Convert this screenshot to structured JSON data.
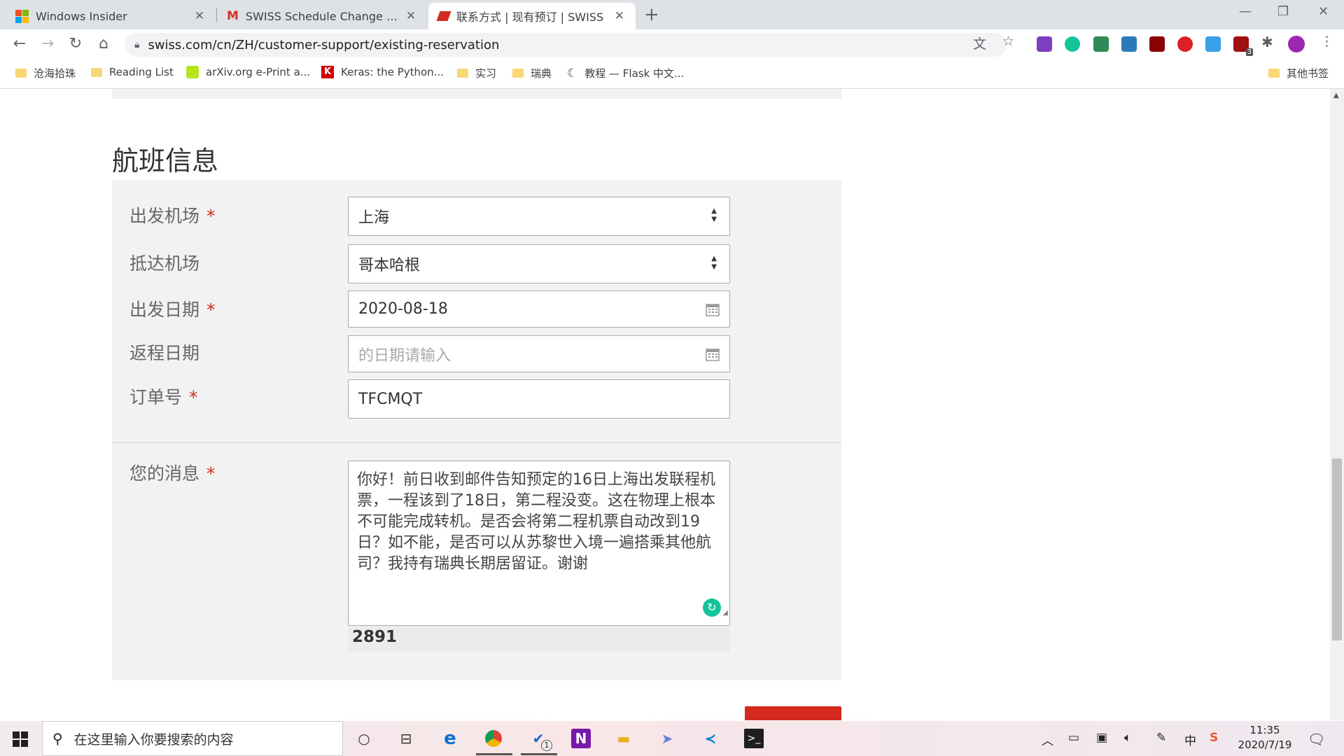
{
  "browser": {
    "tabs": [
      {
        "title": "Windows Insider",
        "active": false
      },
      {
        "title": "SWISS Schedule Change for Bo",
        "active": false
      },
      {
        "title": "联系方式 | 现有预订 | SWISS",
        "active": true
      }
    ],
    "url": "swiss.com/cn/ZH/customer-support/existing-reservation",
    "bookmarks": [
      {
        "label": "沧海拾珠",
        "icon": "folder-icon"
      },
      {
        "label": "Reading List",
        "icon": "folder-icon"
      },
      {
        "label": "arXiv.org e-Print a...",
        "icon": "arxiv-icon"
      },
      {
        "label": "Keras: the Python...",
        "icon": "keras-icon"
      },
      {
        "label": "实习",
        "icon": "folder-icon"
      },
      {
        "label": "瑞典",
        "icon": "folder-icon"
      },
      {
        "label": "教程 — Flask 中文...",
        "icon": "flask-icon"
      }
    ],
    "other_bookmarks": "其他书签",
    "extension_badge": "3"
  },
  "form": {
    "section_title": "航班信息",
    "departure_airport": {
      "label": "出发机场",
      "required_mark": "*",
      "value": "上海"
    },
    "arrival_airport": {
      "label": "抵达机场",
      "value": "哥本哈根"
    },
    "departure_date": {
      "label": "出发日期",
      "required_mark": "*",
      "value": "2020-08-18"
    },
    "return_date": {
      "label": "返程日期",
      "placeholder": "的日期请输入"
    },
    "booking_number": {
      "label": "订单号",
      "required_mark": "*",
      "value": "TFCMQT"
    },
    "message": {
      "label": "您的消息",
      "required_mark": "*",
      "value": "你好！前日收到邮件告知预定的16日上海出发联程机票，一程该到了18日，第二程没变。这在物理上根本不可能完成转机。是否会将第二程机票自动改到19日？如不能，是否可以从苏黎世入境一遍搭乘其他航司？我持有瑞典长期居留证。谢谢",
      "remaining_chars": "2891"
    }
  },
  "taskbar": {
    "search_placeholder": "在这里输入你要搜索的内容",
    "todo_badge": "1",
    "ime": "中",
    "time": "11:35",
    "date": "2020/7/19"
  },
  "colors": {
    "swiss_red": "#d52b1e",
    "panel_bg": "#f2f2f2",
    "grammarly_green": "#15c39a"
  }
}
